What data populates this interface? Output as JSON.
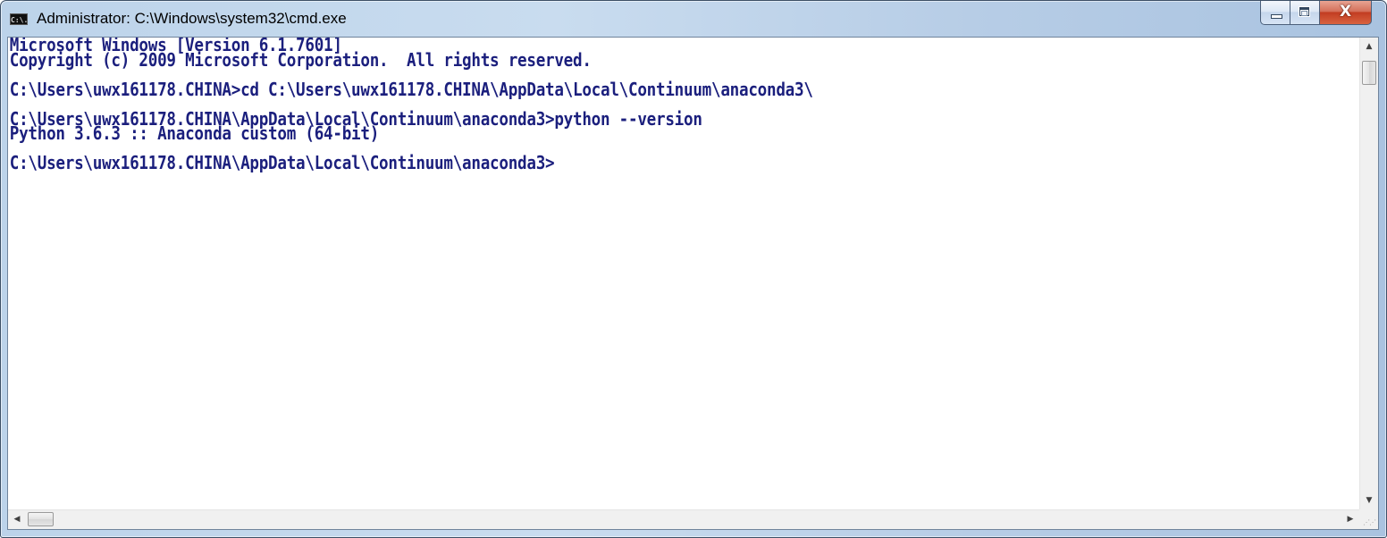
{
  "window": {
    "title": "Administrator: C:\\Windows\\system32\\cmd.exe",
    "icon": "cmd-console-icon",
    "icon_label": "C:\\.",
    "buttons": {
      "minimize": "minimize-icon",
      "maximize": "maximize-icon",
      "close": "close-icon",
      "close_glyph": "X"
    },
    "accent_colors": {
      "frame": "#bcd3ea",
      "close_button": "#c23d22",
      "console_text": "#1b1f7d",
      "console_background": "#ffffff"
    }
  },
  "console": {
    "lines": [
      "Microsoft Windows [Version 6.1.7601]",
      "Copyright (c) 2009 Microsoft Corporation.  All rights reserved.",
      "",
      "C:\\Users\\uwx161178.CHINA>cd C:\\Users\\uwx161178.CHINA\\AppData\\Local\\Continuum\\anaconda3\\",
      "",
      "C:\\Users\\uwx161178.CHINA\\AppData\\Local\\Continuum\\anaconda3>python --version",
      "Python 3.6.3 :: Anaconda custom (64-bit)",
      "",
      "C:\\Users\\uwx161178.CHINA\\AppData\\Local\\Continuum\\anaconda3>"
    ]
  },
  "scrollbars": {
    "up_arrow": "▲",
    "down_arrow": "▼",
    "left_arrow": "◀",
    "right_arrow": "▶",
    "grip": "⋰⋰"
  }
}
